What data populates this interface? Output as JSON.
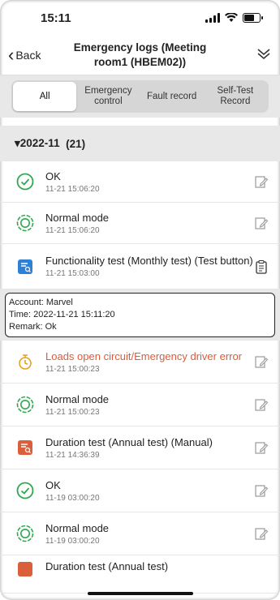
{
  "status": {
    "time": "15:11"
  },
  "nav": {
    "back_label": "Back",
    "title": "Emergency logs (Meeting room1 (HBEM02))"
  },
  "tabs": [
    {
      "label": "All",
      "active": true
    },
    {
      "label": "Emergency control"
    },
    {
      "label": "Fault record"
    },
    {
      "label": "Self-Test Record"
    }
  ],
  "group": {
    "label": "▾2022-11",
    "count": "(21)"
  },
  "entries": [
    {
      "title": "OK",
      "time": "11-21 15:06:20",
      "icon": "ok-check-icon"
    },
    {
      "title": "Normal mode",
      "time": "11-21 15:06:20",
      "icon": "normal-mode-icon"
    },
    {
      "title": "Functionality test (Monthly test) (Test button)",
      "time": "11-21 15:03:00",
      "icon": "test-report-icon"
    },
    {
      "title": "Loads open circuit/Emergency driver error",
      "time": "11-21 15:00:23",
      "icon": "fault-warning-icon"
    },
    {
      "title": "Normal mode",
      "time": "11-21 15:00:23",
      "icon": "normal-mode-icon"
    },
    {
      "title": "Duration test (Annual test) (Manual)",
      "time": "11-21 14:36:39",
      "icon": "duration-report-icon"
    },
    {
      "title": "OK",
      "time": "11-19 03:00:20",
      "icon": "ok-check-icon"
    },
    {
      "title": "Normal mode",
      "time": "11-19 03:00:20",
      "icon": "normal-mode-icon"
    },
    {
      "title": "Duration test (Annual test)",
      "time": "",
      "icon": "duration-report-icon"
    }
  ],
  "detail": {
    "account": "Account: Marvel",
    "time": "Time: 2022-11-21 15:11:20",
    "remark": "Remark: Ok"
  },
  "colors": {
    "ok": "#2fa84f",
    "fault": "#e8a020",
    "fault_text": "#e05a3a",
    "test": "#2e7fd6",
    "duration": "#d9603a"
  }
}
